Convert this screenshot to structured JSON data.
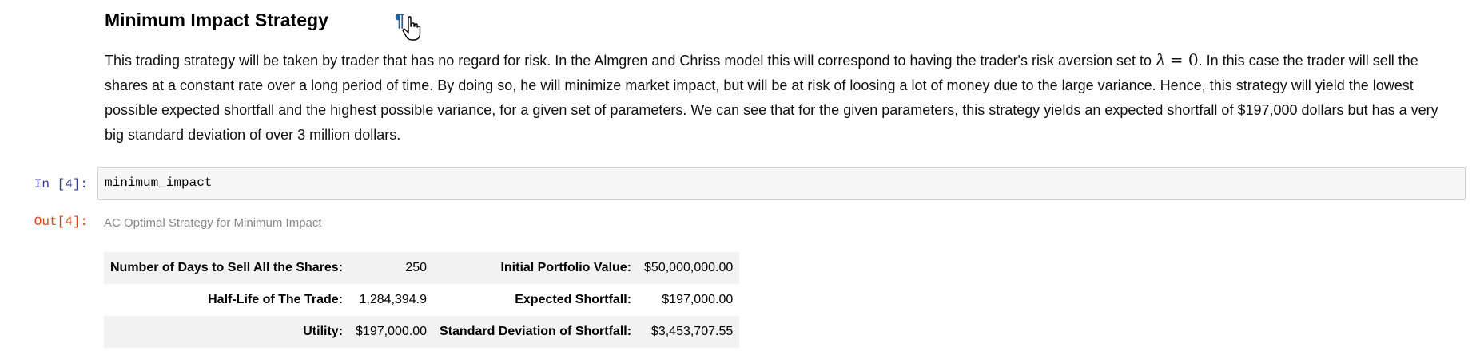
{
  "markdown": {
    "title": "Minimum Impact Strategy",
    "anchor_symbol": "¶",
    "paragraph_before_math": "This trading strategy will be taken by trader that has no regard for risk. In the Almgren and Chriss model this will correspond to having the trader's risk aversion set to",
    "math_lambda": "λ",
    "math_eq_zero": "= 0",
    "paragraph_after_math": ". In this case the trader will sell the shares at a constant rate over a long period of time. By doing so, he will minimize market impact, but will be at risk of loosing a lot of money due to the large variance. Hence, this strategy will yield the lowest possible expected shortfall and the highest possible variance, for a given set of parameters. We can see that for the given parameters, this strategy yields an expected shortfall of $197,000 dollars but has a very big standard deviation of over 3 million dollars."
  },
  "code_cell": {
    "in_prompt": "In [4]:",
    "code": "minimum_impact",
    "out_prompt": "Out[4]:"
  },
  "output": {
    "caption": "AC Optimal Strategy for Minimum Impact",
    "rows": [
      {
        "label1": "Number of Days to Sell All the Shares:",
        "value1": "250",
        "label2": "Initial Portfolio Value:",
        "value2": "$50,000,000.00"
      },
      {
        "label1": "Half-Life of The Trade:",
        "value1": "1,284,394.9",
        "label2": "Expected Shortfall:",
        "value2": "$197,000.00"
      },
      {
        "label1": "Utility:",
        "value1": "$197,000.00",
        "label2": "Standard Deviation of Shortfall:",
        "value2": "$3,453,707.55"
      }
    ]
  }
}
